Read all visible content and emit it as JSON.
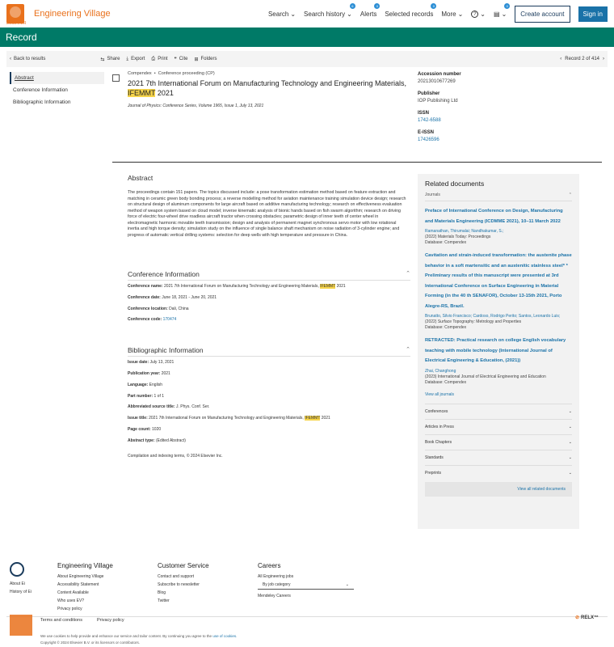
{
  "header": {
    "brand": "Engineering Village",
    "brand_sub": "ELSEVIER",
    "nav": [
      {
        "label": "Search",
        "badge": ""
      },
      {
        "label": "Search history",
        "badge": "6"
      },
      {
        "label": "Alerts",
        "badge": "0"
      },
      {
        "label": "Selected records",
        "badge": "0"
      },
      {
        "label": "More",
        "badge": ""
      }
    ],
    "help_label": "?",
    "folder_badge": "0",
    "create_account": "Create account",
    "sign_in": "Sign in"
  },
  "record_bar": {
    "title": "Record"
  },
  "toolbar": {
    "back": "Back to results",
    "share": "Share",
    "export": "Export",
    "print": "Print",
    "cite": "Cite",
    "folders": "Folders",
    "record_position": "Record 2 of 414"
  },
  "sidenav": {
    "items": [
      "Abstract",
      "Conference Information",
      "Bibliographic Information"
    ]
  },
  "record": {
    "database": "Compendex",
    "doc_type": "Conference proceeding (CP)",
    "title_part1": "2021 7th International Forum on Manufacturing Technology and Engineering Materials,",
    "title_highlight": "IFEMMT",
    "title_part2": "2021",
    "journal": "Journal of Physics: Conference Series, Volume 1965, Issue 1, July 13, 2021"
  },
  "meta": {
    "accession_label": "Accession number",
    "accession": "20213010677269",
    "publisher_label": "Publisher",
    "publisher": "IOP Publishing Ltd",
    "issn_label": "ISSN",
    "issn": "1742-6588",
    "eissn_label": "E-ISSN",
    "eissn": "17426596"
  },
  "abstract": {
    "heading": "Abstract",
    "text": "The proceedings contain 151 papers. The topics discussed include: a pose transformation estimation method based on feature extraction and matching in ceramic green body bonding process; a reverse modelling method for aviation maintenance training simulation device design; research on structural design of aluminum components for large aircraft based on additive manufacturing technology; research on effectiveness evaluation method of weapon system based on cloud model; inverse kinematic analysis of bionic hands based on fish swarm algorithm; research on driving force of electric four-wheel drive roadless aircraft tractor when crossing obstacles; parametric design of inner teeth of center wheel in electromagnetic harmonic movable teeth transmission; design and analysis of permanent magnet synchronous servo motor with low rotational inertia and high torque density; simulation study on the influence of single balance shaft mechanism on noise radiation of 3-cylinder engine; and progress of automatic vertical drilling systems: selection for deep wells with high temperature and pressure in China."
  },
  "conference": {
    "heading": "Conference Information",
    "name_label": "Conference name:",
    "name": "2021 7th International Forum on Manufacturing Technology and Engineering Materials,",
    "name_hl": "IFEMMT",
    "name_end": "2021",
    "date_label": "Conference date:",
    "date": "June 18, 2021 - June 20, 2021",
    "location_label": "Conference location:",
    "location": "Dali, China",
    "code_label": "Conference code:",
    "code": "170474"
  },
  "biblio": {
    "heading": "Bibliographic Information",
    "fields": [
      {
        "label": "Issue date:",
        "value": "July 13, 2021"
      },
      {
        "label": "Publication year:",
        "value": "2021"
      },
      {
        "label": "Language:",
        "value": "English"
      },
      {
        "label": "Part number:",
        "value": "1 of 1"
      },
      {
        "label": "Abbreviated source title:",
        "value": "J. Phys. Conf. Ser."
      }
    ],
    "issue_title_label": "Issue title:",
    "issue_title": "2021 7th International Forum on Manufacturing Technology and Engineering Materials,",
    "issue_title_hl": "IFEMMT",
    "issue_title_end": "2021",
    "page_count_label": "Page count:",
    "page_count": "1020",
    "abstract_type_label": "Abstract type:",
    "abstract_type": "(Edited Abstract)",
    "copyright": "Compilation and indexing terms, © 2024 Elsevier Inc."
  },
  "related": {
    "heading": "Related documents",
    "journals_label": "Journals",
    "docs": [
      {
        "title": "Preface of International Conference on Design, Manufacturing and Materials Engineering (ICDMME 2021), 10–11 March 2022",
        "authors": "Ramanathan, Thirumalai; Nandhakumar, S.;",
        "source": "(2022) Materials Today: Proceedings",
        "db": "Database: Compendex"
      },
      {
        "title": "Cavitation and strain-induced transformation: the austenite phase behavior in a soft martensitic and an austenitic stainless steel* * Preliminary results of this manuscript were presented at 3rd International Conference on Surface Engineering in Material Forming (in the 40 th SENAFOR), October 13-15th 2021, Porto Alegre-RS, Brazil.",
        "authors": "Brunatto, Silvio Francisco; Cardoso, Rodrigo Perito; Santos, Leonardo Luis;",
        "source": "(2022) Surface Topography: Metrology and Properties",
        "db": "Database: Compendex"
      },
      {
        "title": "RETRACTED: Practical research on college English vocabulary teaching with mobile technology (International Journal of Electrical Engineering & Education, (2021))",
        "authors": "Zhai, Changhong",
        "source": "(2023) International Journal of Electrical Engineering and Education",
        "db": "Database: Compendex"
      }
    ],
    "view_all_journals": "View all journals",
    "categories": [
      "Conferences",
      "Articles in Press",
      "Book Chapters",
      "Standards",
      "Preprints"
    ],
    "view_all_related": "View all related documents"
  },
  "footer": {
    "col1": [
      "About Ei",
      "History of Ei"
    ],
    "ev_heading": "Engineering Village",
    "ev_links": [
      "About Engineering Village",
      "Accessibility Statement",
      "Content Available",
      "Who uses EV?",
      "Privacy policy"
    ],
    "cs_heading": "Customer Service",
    "cs_links": [
      "Contact and support",
      "Subscribe to newsletter",
      "Blog",
      "Twitter"
    ],
    "careers_heading": "Careers",
    "careers_links": [
      "All Engineering jobs"
    ],
    "select_label": "By job category",
    "careers_extra": "Mendeley Careers",
    "terms": "Terms and conditions",
    "privacy": "Privacy policy",
    "relx": "RELX™",
    "cookie_text": "We use cookies to help provide and enhance our service and tailor content. By continuing you agree to the",
    "cookie_link": "use of cookies.",
    "copyright": "Copyright © 2024 Elsevier B.V. or its licensors or contributors."
  }
}
